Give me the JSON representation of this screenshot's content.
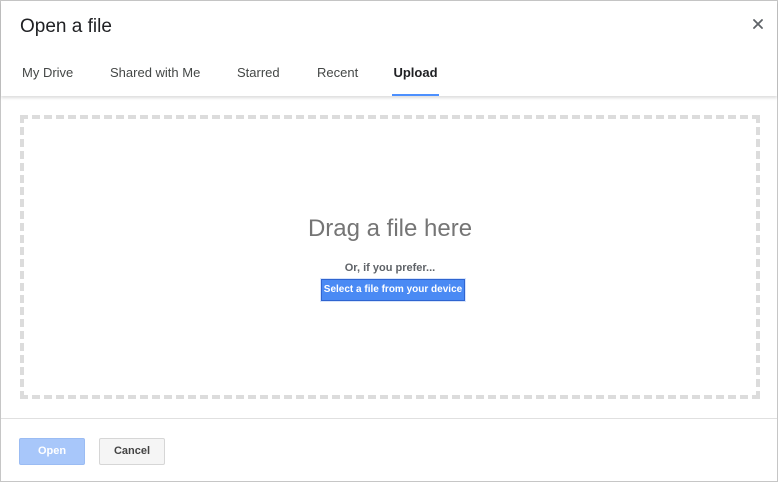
{
  "dialog": {
    "title": "Open a file",
    "close_icon": "close-icon"
  },
  "tabs": [
    {
      "label": "My Drive",
      "active": false
    },
    {
      "label": "Shared with Me",
      "active": false
    },
    {
      "label": "Starred",
      "active": false
    },
    {
      "label": "Recent",
      "active": false
    },
    {
      "label": "Upload",
      "active": true
    }
  ],
  "upload": {
    "drag_text": "Drag a file here",
    "prefer_text": "Or, if you prefer...",
    "select_button": "Select a file from your device"
  },
  "footer": {
    "open_label": "Open",
    "open_enabled": false,
    "cancel_label": "Cancel"
  },
  "colors": {
    "accent": "#4a8af4",
    "tab_underline": "#4d90fe",
    "disabled_button": "#a8c7fa"
  }
}
